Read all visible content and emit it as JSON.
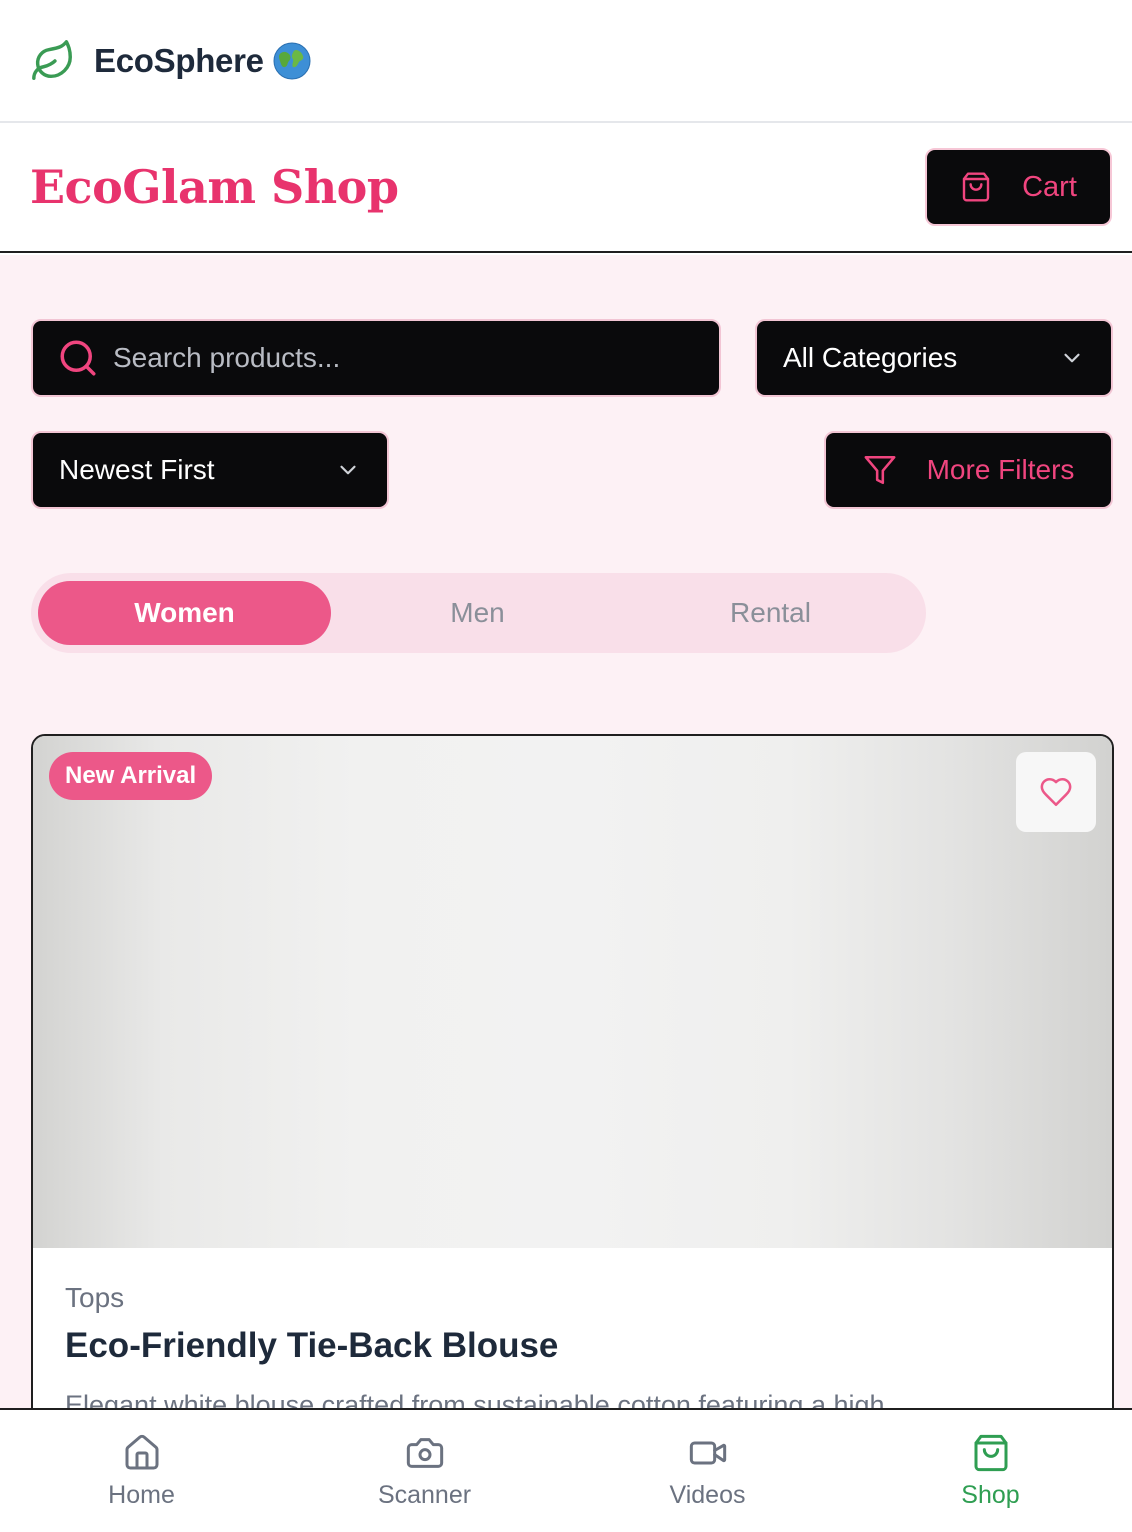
{
  "appbar": {
    "brand": "EcoSphere"
  },
  "shop": {
    "title": "EcoGlam Shop",
    "cart_label": "Cart"
  },
  "search": {
    "placeholder": "Search products..."
  },
  "category": {
    "selected": "All Categories"
  },
  "sort": {
    "selected": "Newest First"
  },
  "filters": {
    "label": "More Filters"
  },
  "tabs": [
    {
      "label": "Women",
      "active": true
    },
    {
      "label": "Men",
      "active": false
    },
    {
      "label": "Rental",
      "active": false
    }
  ],
  "product": {
    "badge": "New Arrival",
    "category": "Tops",
    "title": "Eco-Friendly Tie-Back Blouse",
    "description": "Elegant white blouse crafted from sustainable cotton featuring a high"
  },
  "nav": {
    "items": [
      {
        "label": "Home",
        "icon": "home-icon"
      },
      {
        "label": "Scanner",
        "icon": "camera-icon"
      },
      {
        "label": "Videos",
        "icon": "video-icon"
      },
      {
        "label": "Shop",
        "icon": "shopping-bag-icon",
        "active": true
      }
    ]
  },
  "colors": {
    "brand_pink": "#e8336d",
    "accent_green": "#2f9e52"
  }
}
